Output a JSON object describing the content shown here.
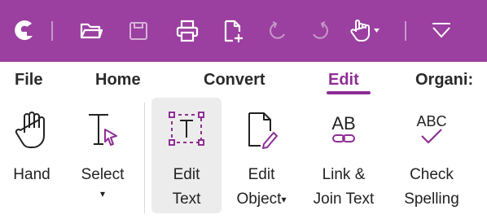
{
  "quick_access": {
    "icons": [
      "app-logo-icon",
      "open-folder-icon",
      "save-icon",
      "print-icon",
      "new-document-icon",
      "undo-icon",
      "redo-icon",
      "hand-tool-icon",
      "customize-toolbar-icon"
    ],
    "accent": "#9b3fa0"
  },
  "tabs": [
    {
      "label": "File"
    },
    {
      "label": "Home"
    },
    {
      "label": "Convert"
    },
    {
      "label": "Edit",
      "active": true
    },
    {
      "label": "Organi:"
    }
  ],
  "ribbon": {
    "buttons": [
      {
        "name": "hand",
        "line1": "Hand",
        "line2": ""
      },
      {
        "name": "select",
        "line1": "Select",
        "line2": "▾"
      },
      {
        "name": "edit-text",
        "line1": "Edit",
        "line2": "Text",
        "active": true
      },
      {
        "name": "edit-object",
        "line1": "Edit",
        "line2": "Object",
        "caret": "▾"
      },
      {
        "name": "link-join-text",
        "line1": "Link &",
        "line2": "Join Text"
      },
      {
        "name": "check-spelling",
        "line1": "Check",
        "line2": "Spelling"
      }
    ],
    "icon_texts": {
      "link_join": "AB",
      "spelling": "ABC"
    }
  },
  "colors": {
    "accent": "#8e2e94",
    "active_bg": "#ececec",
    "text": "#222222"
  }
}
